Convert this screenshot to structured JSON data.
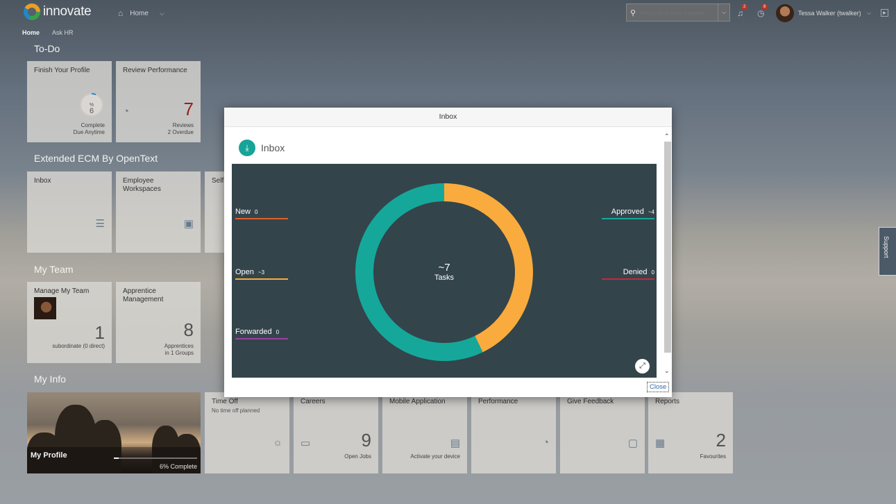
{
  "shell": {
    "brand": "innovate",
    "nav_label": "Home",
    "search_placeholder": "Search for actions or people",
    "notifications_count": "2",
    "todos_count": "8",
    "user_name": "Tessa Walker (twalker)"
  },
  "subnav": {
    "items": [
      "Home",
      "Ask HR"
    ]
  },
  "sections": {
    "todo": "To-Do",
    "ecm": "Extended ECM By OpenText",
    "team": "My Team",
    "info": "My Info"
  },
  "tiles": {
    "finish_profile": {
      "title": "Finish Your Profile",
      "percent": "6",
      "percent_unit": "%",
      "foot1": "Complete",
      "foot2": "Due Anytime"
    },
    "review_perf": {
      "title": "Review Performance",
      "number": "7",
      "foot1": "Reviews",
      "foot2": "2 Overdue"
    },
    "inbox": {
      "title": "Inbox"
    },
    "employee_ws": {
      "title": "Employee Workspaces"
    },
    "self": {
      "title": "Self"
    },
    "manage_team": {
      "title": "Manage My Team",
      "number": "1",
      "foot1": "subordinate (0 direct)"
    },
    "apprentice": {
      "title": "Apprentice Management",
      "number": "8",
      "foot1": "Apprentices",
      "foot2": "in 1 Groups"
    },
    "my_profile": {
      "title": "My Profile",
      "foot": "6% Complete",
      "progress": 0.06
    },
    "time_off": {
      "title": "Time Off",
      "sub": "No time off planned"
    },
    "careers": {
      "title": "Careers",
      "number": "9",
      "foot1": "Open Jobs"
    },
    "mobile": {
      "title": "Mobile Application",
      "foot1": "Activate your device"
    },
    "performance": {
      "title": "Performance"
    },
    "feedback": {
      "title": "Give Feedback"
    },
    "reports": {
      "title": "Reports",
      "number": "2",
      "foot1": "Favourites"
    }
  },
  "support_label": "Support",
  "dialog": {
    "title": "Inbox",
    "card_title": "Inbox",
    "close_label": "Close",
    "legend": [
      {
        "label": "New",
        "count": "0"
      },
      {
        "label": "Open",
        "count": "~3"
      },
      {
        "label": "Forwarded",
        "count": "0"
      },
      {
        "label": "Approved",
        "count": "~4"
      },
      {
        "label": "Denied",
        "count": "0"
      }
    ],
    "center_value": "~7",
    "center_label": "Tasks"
  },
  "chart_data": {
    "type": "pie",
    "categories": [
      "Approved",
      "Open",
      "New",
      "Forwarded",
      "Denied"
    ],
    "values": [
      3,
      4,
      0,
      0,
      0
    ],
    "colors": [
      "#f9ac3d",
      "#15a89a",
      "#e0602f",
      "#9c3fa5",
      "#c8273b"
    ]
  }
}
